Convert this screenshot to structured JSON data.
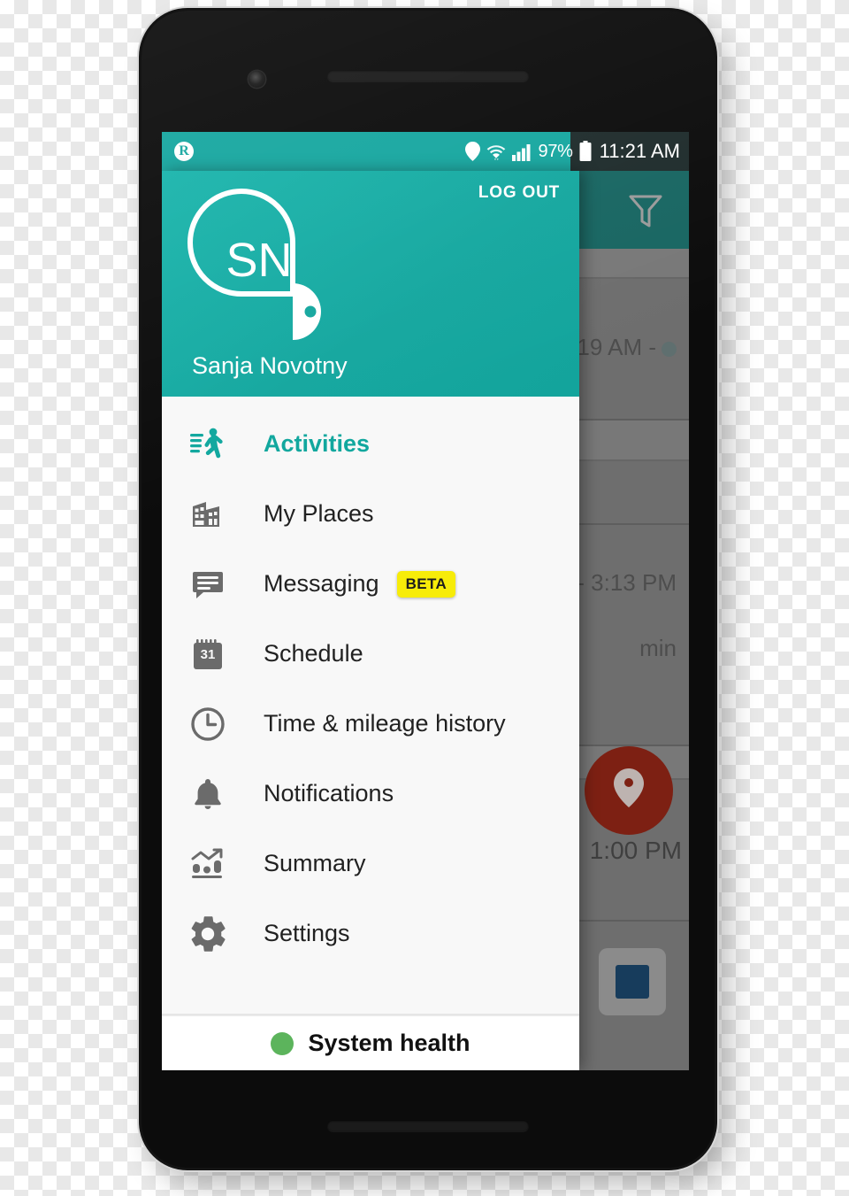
{
  "status_bar": {
    "app_badge": "R",
    "icons": [
      "location-pin-icon",
      "wifi-icon",
      "signal-bars-icon",
      "battery-icon"
    ],
    "battery_percent": "97%",
    "clock": "11:21 AM"
  },
  "drawer": {
    "logout_label": "LOG OUT",
    "avatar_initials": "SN",
    "user_name": "Sanja Novotny",
    "items": [
      {
        "label": "Activities",
        "icon": "running-person-icon",
        "active": true,
        "badge": ""
      },
      {
        "label": "My Places",
        "icon": "building-icon",
        "active": false,
        "badge": ""
      },
      {
        "label": "Messaging",
        "icon": "chat-bubble-icon",
        "active": false,
        "badge": "BETA"
      },
      {
        "label": "Schedule",
        "icon": "calendar-31-icon",
        "active": false,
        "badge": ""
      },
      {
        "label": "Time & mileage history",
        "icon": "clock-icon",
        "active": false,
        "badge": ""
      },
      {
        "label": "Notifications",
        "icon": "bell-icon",
        "active": false,
        "badge": ""
      },
      {
        "label": "Summary",
        "icon": "bar-chart-icon",
        "active": false,
        "badge": ""
      },
      {
        "label": "Settings",
        "icon": "gear-icon",
        "active": false,
        "badge": ""
      }
    ],
    "footer": {
      "status_label": "System health",
      "status_color": "#5cb45c"
    }
  },
  "background_app": {
    "toolbar_icon": "filter-funnel-icon",
    "row_1_time": ":19 AM -",
    "row_2_time": "- 3:13 PM",
    "row_2_duration": "min",
    "fab_icon": "map-pin-icon",
    "fab_time": "1:00 PM",
    "stop_button_icon": "stop-square-icon"
  },
  "colors": {
    "accent_teal": "#15a79f",
    "toolbar_dark_teal": "#186662",
    "badge_yellow": "#f7ec09",
    "health_green": "#5cb45c",
    "fab_red": "#7d2013"
  }
}
